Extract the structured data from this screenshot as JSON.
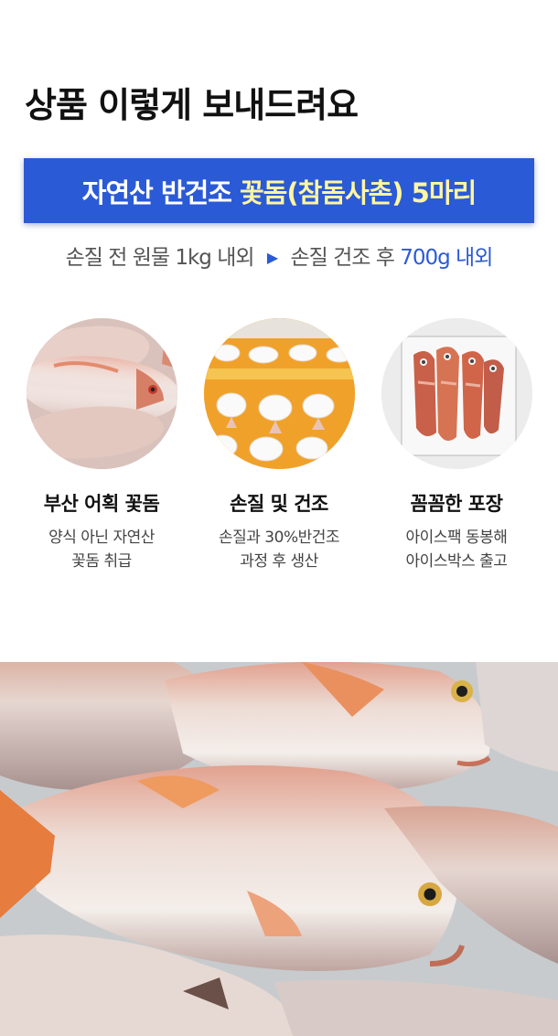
{
  "page": {
    "heading": "상품 이렇게 보내드려요"
  },
  "banner": {
    "text_plain": "자연산 반건조",
    "text_accent": "꽃돔(참돔사촌) 5마리",
    "colors": {
      "background": "#2b5ad6",
      "plain": "#ffffff",
      "accent": "#fff6a0"
    }
  },
  "process": {
    "before": "손질 전 원물 1kg 내외",
    "arrow_icon": "play-arrow-icon",
    "after_prefix": "손질 건조 후",
    "after_value": "700g 내외"
  },
  "features": [
    {
      "title": "부산 어획 꽃돔",
      "desc_line1": "양식 아닌 자연산",
      "desc_line2": "꽃돔 취급",
      "image": "fresh-red-sea-bream-photo"
    },
    {
      "title": "손질 및 건조",
      "desc_line1": "손질과 30%반건조",
      "desc_line2": "과정 후 생산",
      "image": "drying-rack-photo"
    },
    {
      "title": "꼼꼼한 포장",
      "desc_line1": "아이스팩 동봉해",
      "desc_line2": "아이스박스 출고",
      "image": "vacuum-packed-fish-photo"
    }
  ],
  "bottom_photo": {
    "image": "fresh-red-sea-bream-closeup-photo"
  }
}
